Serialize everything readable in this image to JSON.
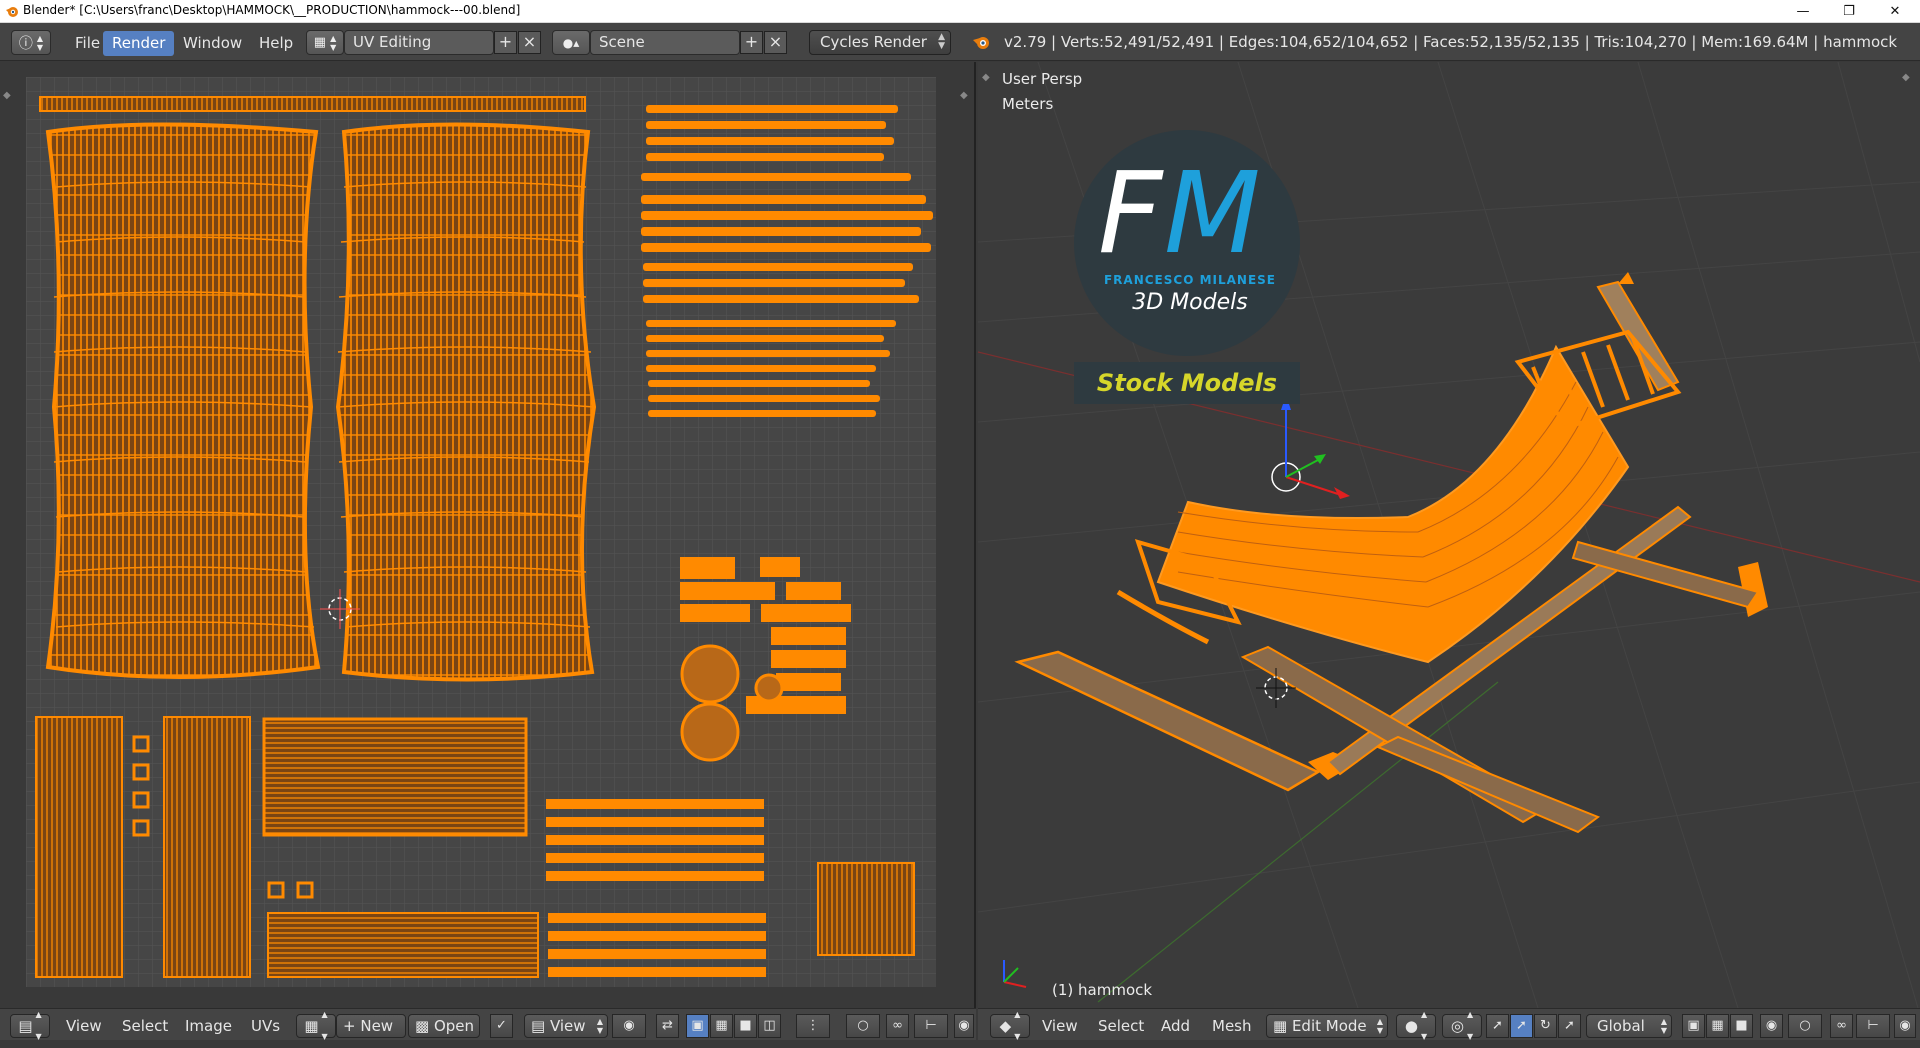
{
  "window": {
    "title": "Blender* [C:\\Users\\franc\\Desktop\\HAMMOCK\\__PRODUCTION\\hammock---00.blend]",
    "controls": [
      "minimize-icon",
      "restore-icon",
      "close-icon"
    ]
  },
  "info_header": {
    "menus": [
      {
        "label": "File",
        "active": false
      },
      {
        "label": "Render",
        "active": true
      },
      {
        "label": "Window",
        "active": false
      },
      {
        "label": "Help",
        "active": false
      }
    ],
    "screen_layout": "UV Editing",
    "scene": "Scene",
    "render_engine": "Cycles Render",
    "stats": "v2.79 | Verts:52,491/52,491 | Edges:104,652/104,652 | Faces:52,135/52,135 | Tris:104,270 | Mem:169.64M | hammock"
  },
  "viewport": {
    "view_label": "User Persp",
    "units_label": "Meters",
    "object_label": "(1) hammock"
  },
  "watermark": {
    "monogram_f": "F",
    "monogram_m": "M",
    "author": "FRANCESCO MILANESE",
    "subtitle": "3D Models",
    "banner": "Stock Models"
  },
  "uv_header": {
    "menus": [
      "View",
      "Select",
      "Image",
      "UVs"
    ],
    "new_label": "New",
    "open_label": "Open",
    "view_label": "View"
  },
  "view3d_header": {
    "menus": [
      "View",
      "Select",
      "Add",
      "Mesh"
    ],
    "mode": "Edit Mode",
    "orientation": "Global"
  },
  "colors": {
    "mesh": "#ff8a00",
    "mesh_dark": "#8a4a10",
    "header": "#444444",
    "active_menu": "#5680c2",
    "logo_blue": "#1ea0db",
    "banner_text": "#d6d62a"
  }
}
